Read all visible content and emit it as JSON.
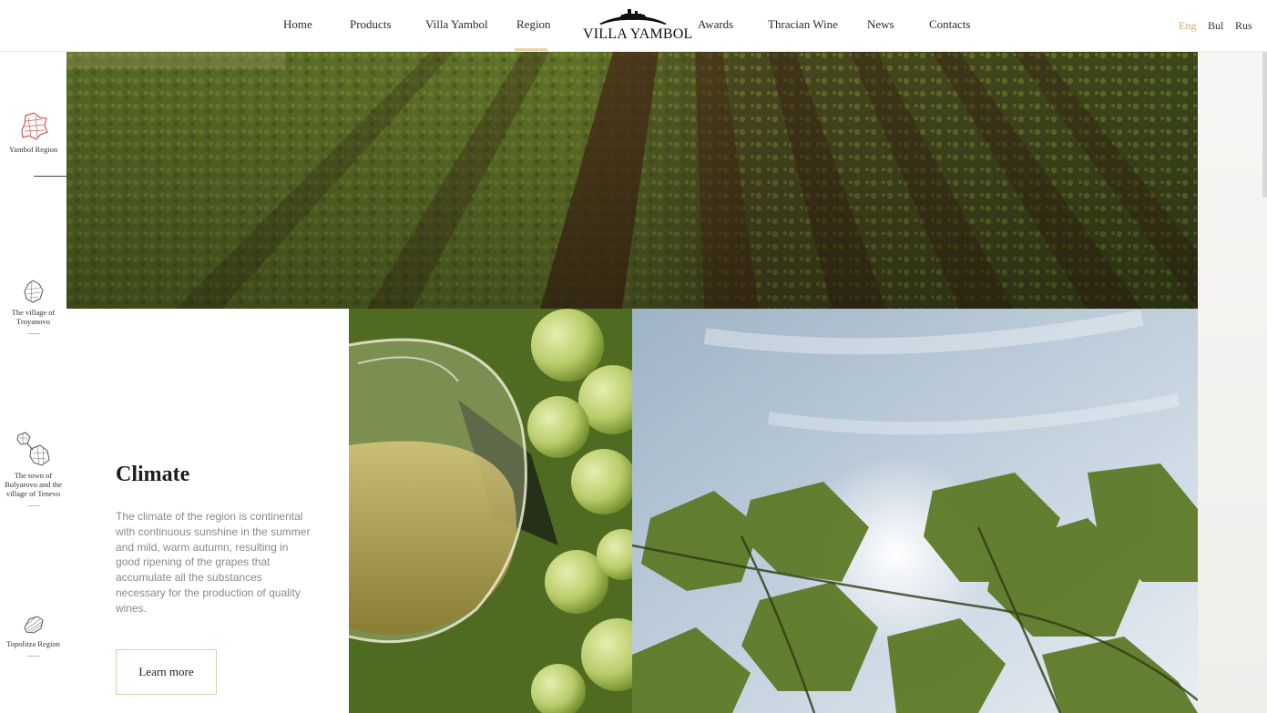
{
  "header": {
    "nav": [
      "Home",
      "Products",
      "Villa Yambol",
      "Region",
      "Awards",
      "Thracian Wine",
      "News",
      "Contacts"
    ],
    "active_nav": "Region",
    "logo_text": "VILLA YAMBOL",
    "languages": [
      "Eng",
      "Bul",
      "Rus"
    ],
    "active_language": "Eng"
  },
  "sidebar": {
    "items": [
      {
        "label": "Yambol Region",
        "icon": "yambol-region-map-icon",
        "active": true
      },
      {
        "label": "The village of Troyanovo",
        "icon": "troyanovo-map-icon",
        "active": false
      },
      {
        "label": "The town of Bolyarovo and the village of Tenevo",
        "icon": "bolyarovo-tenevo-map-icon",
        "active": false
      },
      {
        "label": "Topolitza Region",
        "icon": "topolitza-map-icon",
        "active": false
      }
    ]
  },
  "climate": {
    "title": "Climate",
    "body": "The climate of the region is continental with continuous sunshine in the summer and mild, warm autumn, resulting in good ripening of the grapes that accumulate all the substances necessary for the production of quality wines.",
    "button": "Learn more"
  },
  "colors": {
    "accent_gold": "#c9a867",
    "button_border": "#e0cfa6",
    "active_region_icon": "#c85a5a",
    "body_text": "#8a8a8a"
  }
}
